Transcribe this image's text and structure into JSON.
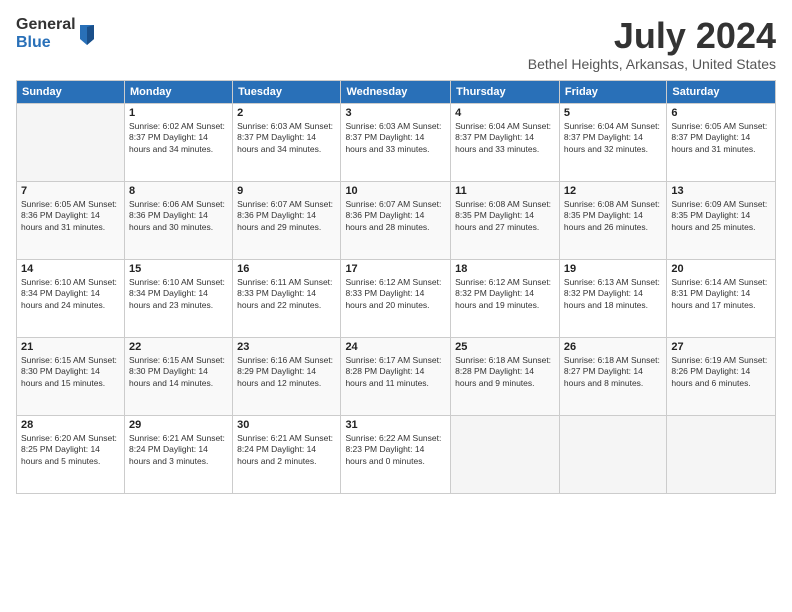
{
  "logo": {
    "general": "General",
    "blue": "Blue"
  },
  "header": {
    "month": "July 2024",
    "location": "Bethel Heights, Arkansas, United States"
  },
  "weekdays": [
    "Sunday",
    "Monday",
    "Tuesday",
    "Wednesday",
    "Thursday",
    "Friday",
    "Saturday"
  ],
  "weeks": [
    [
      {
        "num": "",
        "detail": "",
        "empty": true
      },
      {
        "num": "1",
        "detail": "Sunrise: 6:02 AM\nSunset: 8:37 PM\nDaylight: 14 hours\nand 34 minutes.",
        "empty": false
      },
      {
        "num": "2",
        "detail": "Sunrise: 6:03 AM\nSunset: 8:37 PM\nDaylight: 14 hours\nand 34 minutes.",
        "empty": false
      },
      {
        "num": "3",
        "detail": "Sunrise: 6:03 AM\nSunset: 8:37 PM\nDaylight: 14 hours\nand 33 minutes.",
        "empty": false
      },
      {
        "num": "4",
        "detail": "Sunrise: 6:04 AM\nSunset: 8:37 PM\nDaylight: 14 hours\nand 33 minutes.",
        "empty": false
      },
      {
        "num": "5",
        "detail": "Sunrise: 6:04 AM\nSunset: 8:37 PM\nDaylight: 14 hours\nand 32 minutes.",
        "empty": false
      },
      {
        "num": "6",
        "detail": "Sunrise: 6:05 AM\nSunset: 8:37 PM\nDaylight: 14 hours\nand 31 minutes.",
        "empty": false
      }
    ],
    [
      {
        "num": "7",
        "detail": "Sunrise: 6:05 AM\nSunset: 8:36 PM\nDaylight: 14 hours\nand 31 minutes.",
        "empty": false
      },
      {
        "num": "8",
        "detail": "Sunrise: 6:06 AM\nSunset: 8:36 PM\nDaylight: 14 hours\nand 30 minutes.",
        "empty": false
      },
      {
        "num": "9",
        "detail": "Sunrise: 6:07 AM\nSunset: 8:36 PM\nDaylight: 14 hours\nand 29 minutes.",
        "empty": false
      },
      {
        "num": "10",
        "detail": "Sunrise: 6:07 AM\nSunset: 8:36 PM\nDaylight: 14 hours\nand 28 minutes.",
        "empty": false
      },
      {
        "num": "11",
        "detail": "Sunrise: 6:08 AM\nSunset: 8:35 PM\nDaylight: 14 hours\nand 27 minutes.",
        "empty": false
      },
      {
        "num": "12",
        "detail": "Sunrise: 6:08 AM\nSunset: 8:35 PM\nDaylight: 14 hours\nand 26 minutes.",
        "empty": false
      },
      {
        "num": "13",
        "detail": "Sunrise: 6:09 AM\nSunset: 8:35 PM\nDaylight: 14 hours\nand 25 minutes.",
        "empty": false
      }
    ],
    [
      {
        "num": "14",
        "detail": "Sunrise: 6:10 AM\nSunset: 8:34 PM\nDaylight: 14 hours\nand 24 minutes.",
        "empty": false
      },
      {
        "num": "15",
        "detail": "Sunrise: 6:10 AM\nSunset: 8:34 PM\nDaylight: 14 hours\nand 23 minutes.",
        "empty": false
      },
      {
        "num": "16",
        "detail": "Sunrise: 6:11 AM\nSunset: 8:33 PM\nDaylight: 14 hours\nand 22 minutes.",
        "empty": false
      },
      {
        "num": "17",
        "detail": "Sunrise: 6:12 AM\nSunset: 8:33 PM\nDaylight: 14 hours\nand 20 minutes.",
        "empty": false
      },
      {
        "num": "18",
        "detail": "Sunrise: 6:12 AM\nSunset: 8:32 PM\nDaylight: 14 hours\nand 19 minutes.",
        "empty": false
      },
      {
        "num": "19",
        "detail": "Sunrise: 6:13 AM\nSunset: 8:32 PM\nDaylight: 14 hours\nand 18 minutes.",
        "empty": false
      },
      {
        "num": "20",
        "detail": "Sunrise: 6:14 AM\nSunset: 8:31 PM\nDaylight: 14 hours\nand 17 minutes.",
        "empty": false
      }
    ],
    [
      {
        "num": "21",
        "detail": "Sunrise: 6:15 AM\nSunset: 8:30 PM\nDaylight: 14 hours\nand 15 minutes.",
        "empty": false
      },
      {
        "num": "22",
        "detail": "Sunrise: 6:15 AM\nSunset: 8:30 PM\nDaylight: 14 hours\nand 14 minutes.",
        "empty": false
      },
      {
        "num": "23",
        "detail": "Sunrise: 6:16 AM\nSunset: 8:29 PM\nDaylight: 14 hours\nand 12 minutes.",
        "empty": false
      },
      {
        "num": "24",
        "detail": "Sunrise: 6:17 AM\nSunset: 8:28 PM\nDaylight: 14 hours\nand 11 minutes.",
        "empty": false
      },
      {
        "num": "25",
        "detail": "Sunrise: 6:18 AM\nSunset: 8:28 PM\nDaylight: 14 hours\nand 9 minutes.",
        "empty": false
      },
      {
        "num": "26",
        "detail": "Sunrise: 6:18 AM\nSunset: 8:27 PM\nDaylight: 14 hours\nand 8 minutes.",
        "empty": false
      },
      {
        "num": "27",
        "detail": "Sunrise: 6:19 AM\nSunset: 8:26 PM\nDaylight: 14 hours\nand 6 minutes.",
        "empty": false
      }
    ],
    [
      {
        "num": "28",
        "detail": "Sunrise: 6:20 AM\nSunset: 8:25 PM\nDaylight: 14 hours\nand 5 minutes.",
        "empty": false
      },
      {
        "num": "29",
        "detail": "Sunrise: 6:21 AM\nSunset: 8:24 PM\nDaylight: 14 hours\nand 3 minutes.",
        "empty": false
      },
      {
        "num": "30",
        "detail": "Sunrise: 6:21 AM\nSunset: 8:24 PM\nDaylight: 14 hours\nand 2 minutes.",
        "empty": false
      },
      {
        "num": "31",
        "detail": "Sunrise: 6:22 AM\nSunset: 8:23 PM\nDaylight: 14 hours\nand 0 minutes.",
        "empty": false
      },
      {
        "num": "",
        "detail": "",
        "empty": true
      },
      {
        "num": "",
        "detail": "",
        "empty": true
      },
      {
        "num": "",
        "detail": "",
        "empty": true
      }
    ]
  ]
}
